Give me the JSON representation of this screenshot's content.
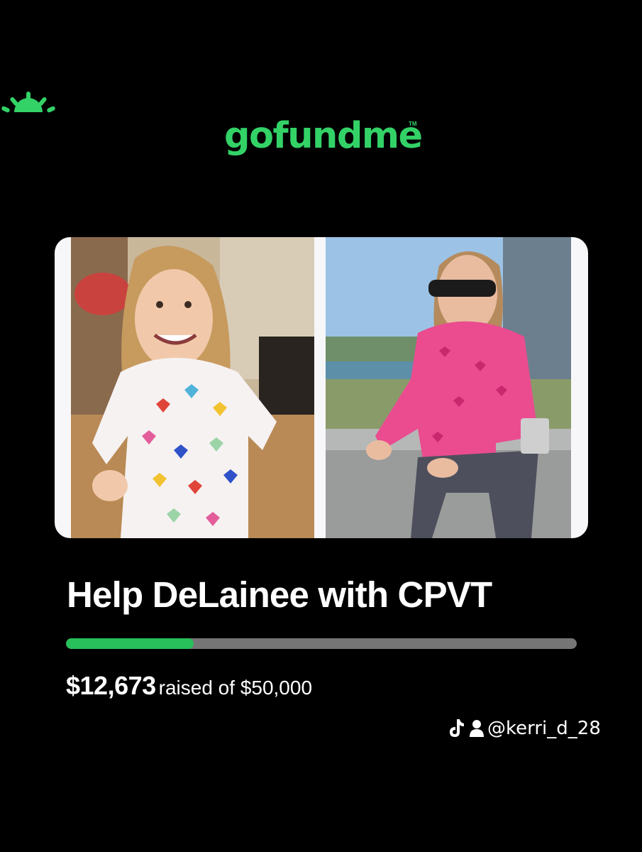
{
  "brand": {
    "name": "gofundme",
    "tm": "TM",
    "color": "#33d267",
    "icon": "sun-rays-icon"
  },
  "campaign": {
    "title": "Help DeLainee with CPVT",
    "amount_raised": "$12,673",
    "raised_suffix": "raised of $50,000",
    "progress_fraction": 0.25,
    "progress_color": "#27c05a"
  },
  "photos": [
    {
      "name": "girl-heart-pajamas-photo"
    },
    {
      "name": "girl-sunglasses-rooftop-photo"
    }
  ],
  "watermark": {
    "icons": [
      "tiktok-icon",
      "user-icon"
    ],
    "handle": "@kerri_d_28"
  }
}
